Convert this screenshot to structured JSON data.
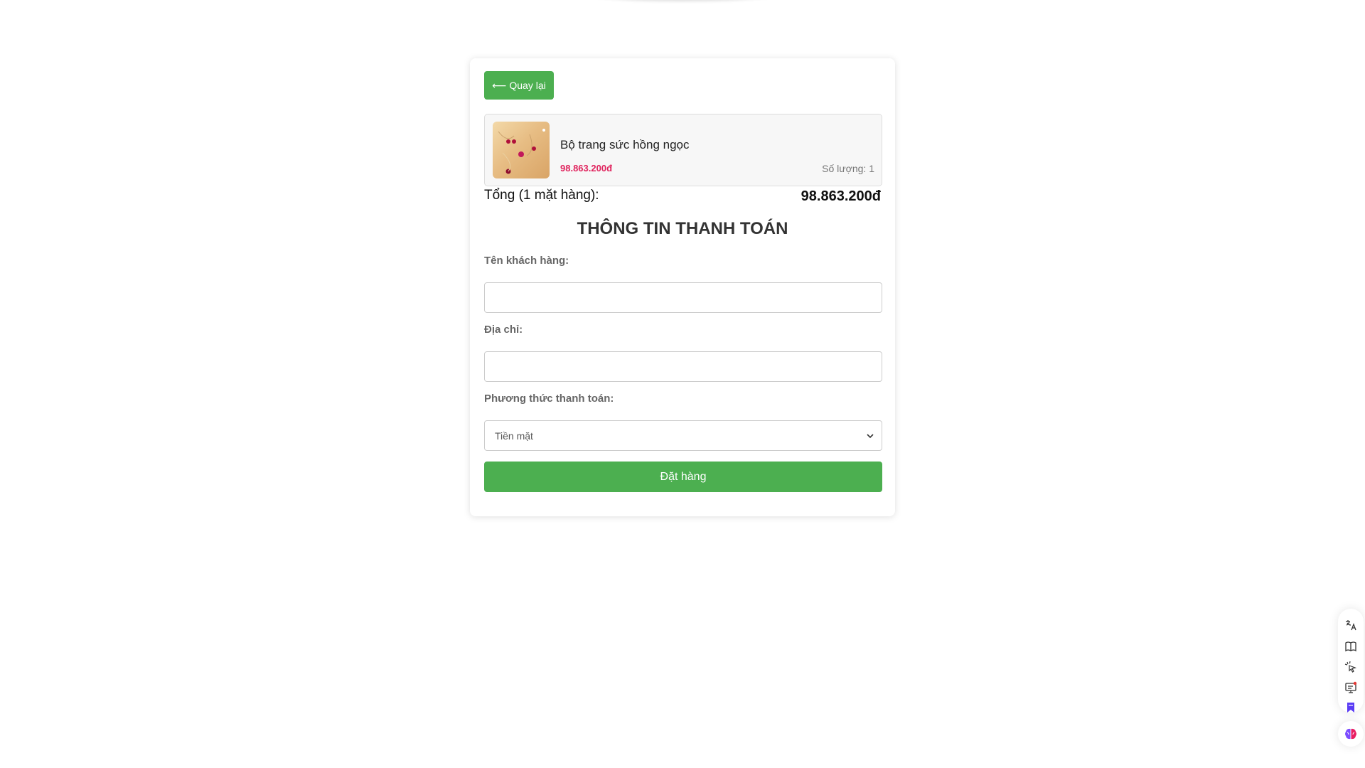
{
  "back_button": {
    "label": "Quay lại"
  },
  "cart_item": {
    "name": "Bộ trang sức hồng ngọc",
    "price": "98.863.200đ",
    "quantity": "Số lượng: 1"
  },
  "total": {
    "label": "Tổng (1 mặt hàng):",
    "value": "98.863.200đ"
  },
  "payment_form": {
    "title": "THÔNG TIN THANH TOÁN",
    "customer_name_label": "Tên khách hàng:",
    "customer_name_value": "",
    "address_label": "Địa chỉ:",
    "address_value": "",
    "payment_method_label": "Phương thức thanh toán:",
    "payment_method_selected": "Tiền mặt",
    "submit_label": "Đặt hàng"
  },
  "colors": {
    "accent_green": "#4caf50",
    "price_pink": "#e0245e"
  },
  "side_toolbar": {
    "icons": [
      "translate-icon",
      "book-icon",
      "cursor-click-icon",
      "screen-notify-icon",
      "bookmark-icon"
    ],
    "ai_icon": "brain-icon"
  }
}
